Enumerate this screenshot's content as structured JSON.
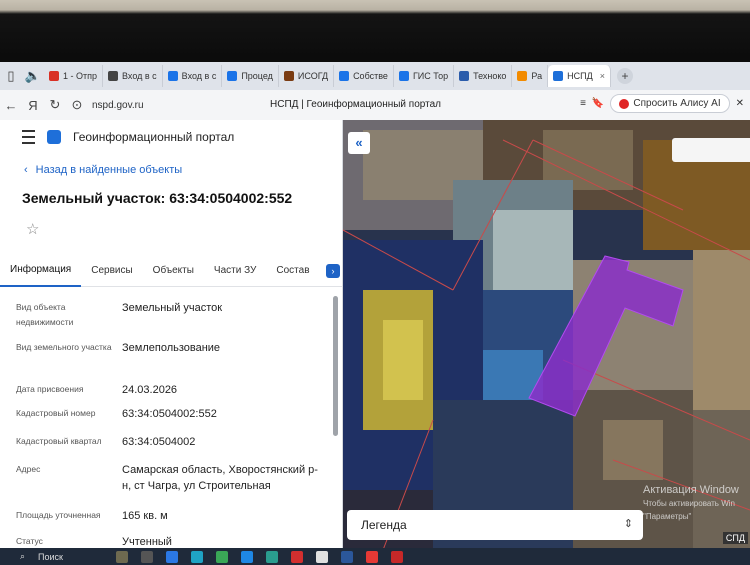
{
  "browser": {
    "tabs": [
      {
        "label": "1 - Отпр",
        "color": "#d93025",
        "active": false
      },
      {
        "label": "Вход в с",
        "color": "#444444",
        "active": false
      },
      {
        "label": "Вход в с",
        "color": "#1a73e8",
        "active": false
      },
      {
        "label": "Процед",
        "color": "#1a73e8",
        "active": false
      },
      {
        "label": "ИСОГД",
        "color": "#7a3b12",
        "active": false
      },
      {
        "label": "Собстве",
        "color": "#1a73e8",
        "active": false
      },
      {
        "label": "ГИС Тор",
        "color": "#1a73e8",
        "active": false
      },
      {
        "label": "Техноко",
        "color": "#2b5cab",
        "active": false
      },
      {
        "label": "Ра",
        "color": "#f28b00",
        "active": false
      },
      {
        "label": "НСПД",
        "color": "#1e6fd9",
        "active": true
      }
    ],
    "new_tab": "+",
    "url": "nspd.gov.ru",
    "page_title": "НСПД | Геоинформационный портал",
    "alice_label": "Спросить Алису AI"
  },
  "panel": {
    "portal_name": "Геоинформационный портал",
    "back_link": "Назад в найденные объекты",
    "object_title": "Земельный участок: 63:34:0504002:552",
    "tabs": [
      "Информация",
      "Сервисы",
      "Объекты",
      "Части ЗУ",
      "Состав"
    ],
    "rows": [
      {
        "label": "Вид объекта недвижимости",
        "value": "Земельный участок"
      },
      {
        "label": "Вид земельного участка",
        "value": "Землепользование"
      },
      {
        "label": "Дата присвоения",
        "value": "24.03.2026"
      },
      {
        "label": "Кадастровый номер",
        "value": "63:34:0504002:552"
      },
      {
        "label": "Кадастровый квартал",
        "value": "63:34:0504002"
      },
      {
        "label": "Адрес",
        "value": "Самарская область, Хворостянский р-н, ст Чагра, ул Строительная"
      },
      {
        "label": "Площадь уточненная",
        "value": "165 кв. м"
      },
      {
        "label": "Статус",
        "value": "Учтенный"
      }
    ]
  },
  "map": {
    "collapse_icon": "«",
    "legend_label": "Легенда",
    "watermark_line1": "Активация Window",
    "watermark_line2": "Чтобы активировать Win",
    "watermark_line3": "\"Параметры\"",
    "scale_label": "СПД",
    "parcel_color": "#8a2fc8"
  },
  "taskbar": {
    "search_label": "Поиск"
  }
}
